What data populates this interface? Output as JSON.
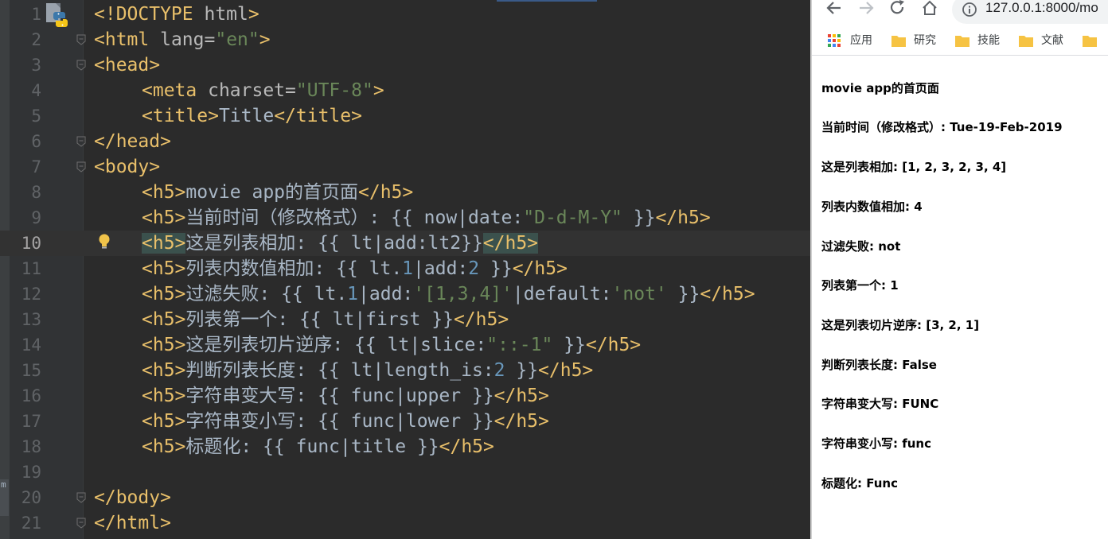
{
  "editor": {
    "lines": [
      {
        "n": "1",
        "tokens": [
          {
            "t": "tag",
            "v": "<!DOCTYPE "
          },
          {
            "t": "attr",
            "v": "html"
          },
          {
            "t": "tag",
            "v": ">"
          }
        ]
      },
      {
        "n": "2",
        "tokens": [
          {
            "t": "tag",
            "v": "<html "
          },
          {
            "t": "attr",
            "v": "lang="
          },
          {
            "t": "str",
            "v": "\"en\""
          },
          {
            "t": "tag",
            "v": ">"
          }
        ]
      },
      {
        "n": "3",
        "tokens": [
          {
            "t": "tag",
            "v": "<head>"
          }
        ]
      },
      {
        "n": "4",
        "indent": true,
        "tokens": [
          {
            "t": "tag",
            "v": "<meta "
          },
          {
            "t": "attr",
            "v": "charset="
          },
          {
            "t": "str",
            "v": "\"UTF-8\""
          },
          {
            "t": "tag",
            "v": ">"
          }
        ]
      },
      {
        "n": "5",
        "indent": true,
        "tokens": [
          {
            "t": "tag",
            "v": "<title>"
          },
          {
            "t": "txt",
            "v": "Title"
          },
          {
            "t": "tag",
            "v": "</title>"
          }
        ]
      },
      {
        "n": "6",
        "tokens": [
          {
            "t": "tag",
            "v": "</head>"
          }
        ]
      },
      {
        "n": "7",
        "tokens": [
          {
            "t": "tag",
            "v": "<body>"
          }
        ]
      },
      {
        "n": "8",
        "indent": true,
        "tokens": [
          {
            "t": "tag",
            "v": "<h5>"
          },
          {
            "t": "txt",
            "v": "movie app的首页面"
          },
          {
            "t": "tag",
            "v": "</h5>"
          }
        ]
      },
      {
        "n": "9",
        "indent": true,
        "tokens": [
          {
            "t": "tag",
            "v": "<h5>"
          },
          {
            "t": "txt",
            "v": "当前时间（修改格式）: {{ now|date:"
          },
          {
            "t": "str",
            "v": "\"D-d-M-Y\""
          },
          {
            "t": "txt",
            "v": " }}"
          },
          {
            "t": "tag",
            "v": "</h5>"
          }
        ]
      },
      {
        "n": "10",
        "indent": true,
        "current": true,
        "tokens": [
          {
            "t": "tag hl",
            "v": "<h5>"
          },
          {
            "t": "txt",
            "v": "这是列表相加: {{ lt|add:lt2}}"
          },
          {
            "t": "tag hl",
            "v": "</h5>"
          }
        ]
      },
      {
        "n": "11",
        "indent": true,
        "tokens": [
          {
            "t": "tag",
            "v": "<h5>"
          },
          {
            "t": "txt",
            "v": "列表内数值相加: {{ lt."
          },
          {
            "t": "num",
            "v": "1"
          },
          {
            "t": "txt",
            "v": "|add:"
          },
          {
            "t": "num",
            "v": "2"
          },
          {
            "t": "txt",
            "v": " }}"
          },
          {
            "t": "tag",
            "v": "</h5>"
          }
        ]
      },
      {
        "n": "12",
        "indent": true,
        "tokens": [
          {
            "t": "tag",
            "v": "<h5>"
          },
          {
            "t": "txt",
            "v": "过滤失败: {{ lt."
          },
          {
            "t": "num",
            "v": "1"
          },
          {
            "t": "txt",
            "v": "|add:"
          },
          {
            "t": "str",
            "v": "'[1,3,4]'"
          },
          {
            "t": "txt",
            "v": "|default:"
          },
          {
            "t": "str",
            "v": "'not'"
          },
          {
            "t": "txt",
            "v": " }}"
          },
          {
            "t": "tag",
            "v": "</h5>"
          }
        ]
      },
      {
        "n": "13",
        "indent": true,
        "tokens": [
          {
            "t": "tag",
            "v": "<h5>"
          },
          {
            "t": "txt",
            "v": "列表第一个: {{ lt|first }}"
          },
          {
            "t": "tag",
            "v": "</h5>"
          }
        ]
      },
      {
        "n": "14",
        "indent": true,
        "tokens": [
          {
            "t": "tag",
            "v": "<h5>"
          },
          {
            "t": "txt",
            "v": "这是列表切片逆序: {{ lt|slice:"
          },
          {
            "t": "str",
            "v": "\"::-1\""
          },
          {
            "t": "txt",
            "v": " }}"
          },
          {
            "t": "tag",
            "v": "</h5>"
          }
        ]
      },
      {
        "n": "15",
        "indent": true,
        "tokens": [
          {
            "t": "tag",
            "v": "<h5>"
          },
          {
            "t": "txt",
            "v": "判断列表长度: {{ lt|length_is:"
          },
          {
            "t": "num",
            "v": "2"
          },
          {
            "t": "txt",
            "v": " }}"
          },
          {
            "t": "tag",
            "v": "</h5>"
          }
        ]
      },
      {
        "n": "16",
        "indent": true,
        "tokens": [
          {
            "t": "tag",
            "v": "<h5>"
          },
          {
            "t": "txt",
            "v": "字符串变大写: {{ func|upper }}"
          },
          {
            "t": "tag",
            "v": "</h5>"
          }
        ]
      },
      {
        "n": "17",
        "indent": true,
        "tokens": [
          {
            "t": "tag",
            "v": "<h5>"
          },
          {
            "t": "txt",
            "v": "字符串变小写: {{ func|lower }}"
          },
          {
            "t": "tag",
            "v": "</h5>"
          }
        ]
      },
      {
        "n": "18",
        "indent": true,
        "tokens": [
          {
            "t": "tag",
            "v": "<h5>"
          },
          {
            "t": "txt",
            "v": "标题化: {{ func|title }}"
          },
          {
            "t": "tag",
            "v": "</h5>"
          }
        ]
      },
      {
        "n": "19",
        "tokens": []
      },
      {
        "n": "20",
        "tokens": [
          {
            "t": "tag",
            "v": "</body>"
          }
        ]
      },
      {
        "n": "21",
        "tokens": [
          {
            "t": "tag",
            "v": "</html>"
          }
        ]
      }
    ],
    "fold_lines": [
      "2",
      "3",
      "6",
      "7",
      "20",
      "21"
    ],
    "left_strip_label": "m"
  },
  "browser": {
    "url": "127.0.0.1:8000/mo",
    "bookmarks": [
      {
        "label": "应用",
        "icon": "apps-grid-icon"
      },
      {
        "label": "研究",
        "icon": "folder-icon"
      },
      {
        "label": "技能",
        "icon": "folder-icon"
      },
      {
        "label": "文献",
        "icon": "folder-icon"
      },
      {
        "label": "",
        "icon": "folder-icon"
      }
    ],
    "headings": [
      "movie app的首页面",
      "当前时间（修改格式）: Tue-19-Feb-2019",
      "这是列表相加: [1, 2, 3, 2, 3, 4]",
      "列表内数值相加: 4",
      "过滤失败: not",
      "列表第一个: 1",
      "这是列表切片逆序: [3, 2, 1]",
      "判断列表长度: False",
      "字符串变大写: FUNC",
      "字符串变小写: func",
      "标题化: Func"
    ]
  },
  "colors": {
    "editor_bg": "#2b2b2b",
    "tag": "#e8bf6a",
    "string": "#6a8759",
    "number": "#6897bb",
    "text": "#a9b7c6",
    "folder": "#f6c343"
  }
}
